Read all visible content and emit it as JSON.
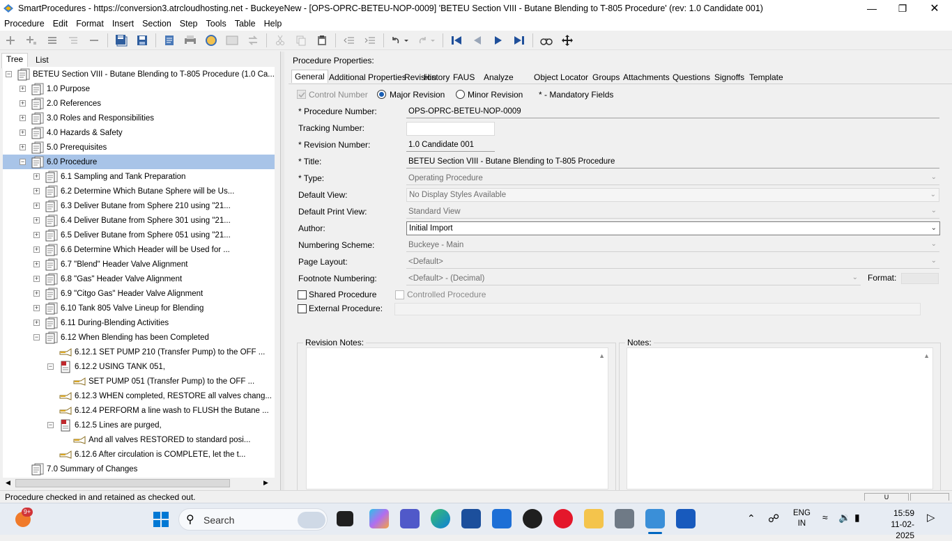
{
  "window": {
    "title": "SmartProcedures - https://conversion3.atrcloudhosting.net - BuckeyeNew - [OPS-OPRC-BETEU-NOP-0009] 'BETEU Section VIII - Butane Blending to T-805 Procedure' (rev: 1.0 Candidate 001)"
  },
  "menu": [
    "Procedure",
    "Edit",
    "Format",
    "Insert",
    "Section",
    "Step",
    "Tools",
    "Table",
    "Help"
  ],
  "left_tabs": [
    "Tree",
    "List"
  ],
  "tree": {
    "root": "BETEU Section VIII - Butane Blending to T-805 Procedure (1.0 Ca...",
    "items": [
      "1.0 Purpose",
      "2.0 References",
      "3.0 Roles and Responsibilities",
      "4.0 Hazards & Safety",
      "5.0 Prerequisites",
      "6.0 Procedure",
      "6.1 Sampling and Tank Preparation",
      "6.2 Determine Which Butane Sphere will be Us...",
      "6.3 Deliver Butane from Sphere 210 using \"21...",
      "6.4 Deliver Butane from Sphere 301 using \"21...",
      "6.5 Deliver Butane from Sphere 051 using \"21...",
      "6.6 Determine Which Header will be Used for ...",
      "6.7 \"Blend\" Header Valve Alignment",
      "6.8 \"Gas\" Header Valve Alignment",
      "6.9 \"Citgo Gas\" Header Valve Alignment",
      "6.10 Tank 805 Valve Lineup for Blending",
      "6.11 During-Blending Activities",
      "6.12 When Blending has been Completed",
      "6.12.1 SET PUMP 210 (Transfer Pump) to the OFF ...",
      "6.12.2 USING TANK 051,",
      "SET PUMP 051 (Transfer Pump) to the OFF ...",
      "6.12.3 WHEN completed, RESTORE all valves chang...",
      "6.12.4 PERFORM a line wash to FLUSH the Butane ...",
      "6.12.5 Lines are purged,",
      "And all valves RESTORED to standard posi...",
      "6.12.6 After circulation is COMPLETE, let the t...",
      "7.0 Summary of Changes"
    ]
  },
  "props": {
    "header": "Procedure Properties:",
    "tabs": [
      "General",
      "Additional Properties",
      "Revision",
      "History",
      "FAUS",
      "Analyze",
      "Object Locator",
      "Groups",
      "Attachments",
      "Questions",
      "Signoffs",
      "Template"
    ],
    "control_number": "Control Number",
    "major_revision": "Major Revision",
    "minor_revision": "Minor Revision",
    "mandatory_note": "* - Mandatory Fields",
    "procedure_number_label": "* Procedure Number:",
    "procedure_number": "OPS-OPRC-BETEU-NOP-0009",
    "tracking_number_label": "Tracking Number:",
    "tracking_number": "",
    "revision_number_label": "* Revision Number:",
    "revision_number": "1.0 Candidate 001",
    "title_label": "* Title:",
    "title": "BETEU Section VIII - Butane Blending to T-805 Procedure",
    "type_label": "* Type:",
    "type": "Operating Procedure",
    "default_view_label": "Default View:",
    "default_view": "No Display Styles Available",
    "default_print_view_label": "Default Print View:",
    "default_print_view": "Standard View",
    "author_label": "Author:",
    "author": "Initial Import",
    "numbering_scheme_label": "Numbering Scheme:",
    "numbering_scheme": "Buckeye - Main",
    "page_layout_label": "Page Layout:",
    "page_layout": "<Default>",
    "footnote_label": "Footnote Numbering:",
    "footnote": "<Default> - (Decimal)",
    "format_label": "Format:",
    "shared_procedure": "Shared Procedure",
    "controlled_procedure": "Controlled Procedure",
    "external_procedure": "External Procedure:",
    "revision_notes": "Revision Notes:",
    "notes": "Notes:"
  },
  "status": {
    "message": "Procedure checked in and retained as checked out.",
    "indicator": "U"
  },
  "taskbar": {
    "search": "Search",
    "badge": "9+",
    "lang1": "ENG",
    "lang2": "IN",
    "time": "15:59",
    "date": "11-02-2025"
  }
}
